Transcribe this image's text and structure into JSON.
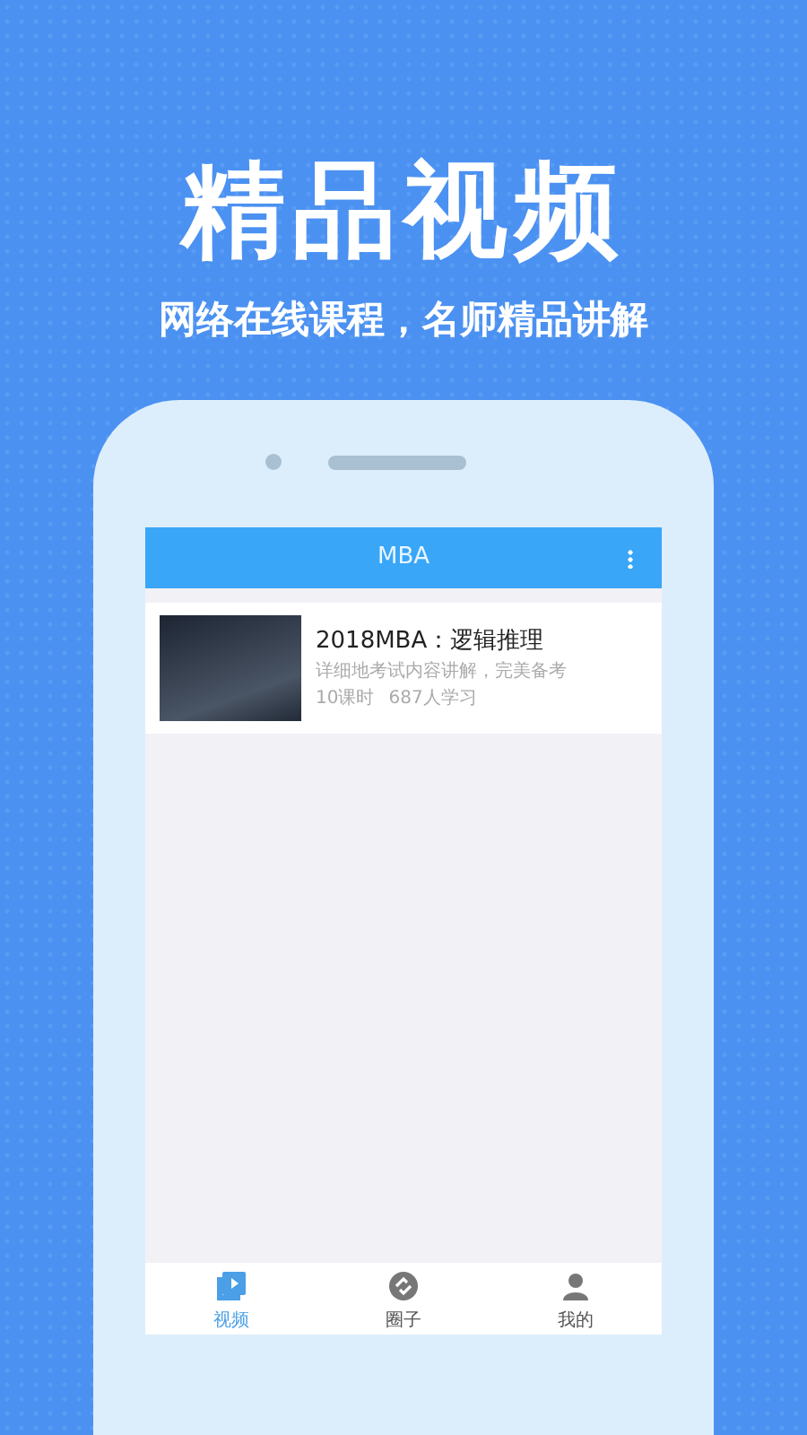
{
  "headline": "精品视频",
  "tagline": "网络在线课程，名师精品讲解",
  "app_bar": {
    "title": "MBA"
  },
  "courses": [
    {
      "title": "2018MBA：逻辑推理",
      "description": "详细地考试内容讲解，完美备考",
      "lessons": "10课时",
      "learners": "687人学习"
    }
  ],
  "tabs": [
    {
      "label": "视频",
      "selected": true
    },
    {
      "label": "圈子",
      "selected": false
    },
    {
      "label": "我的",
      "selected": false
    }
  ]
}
